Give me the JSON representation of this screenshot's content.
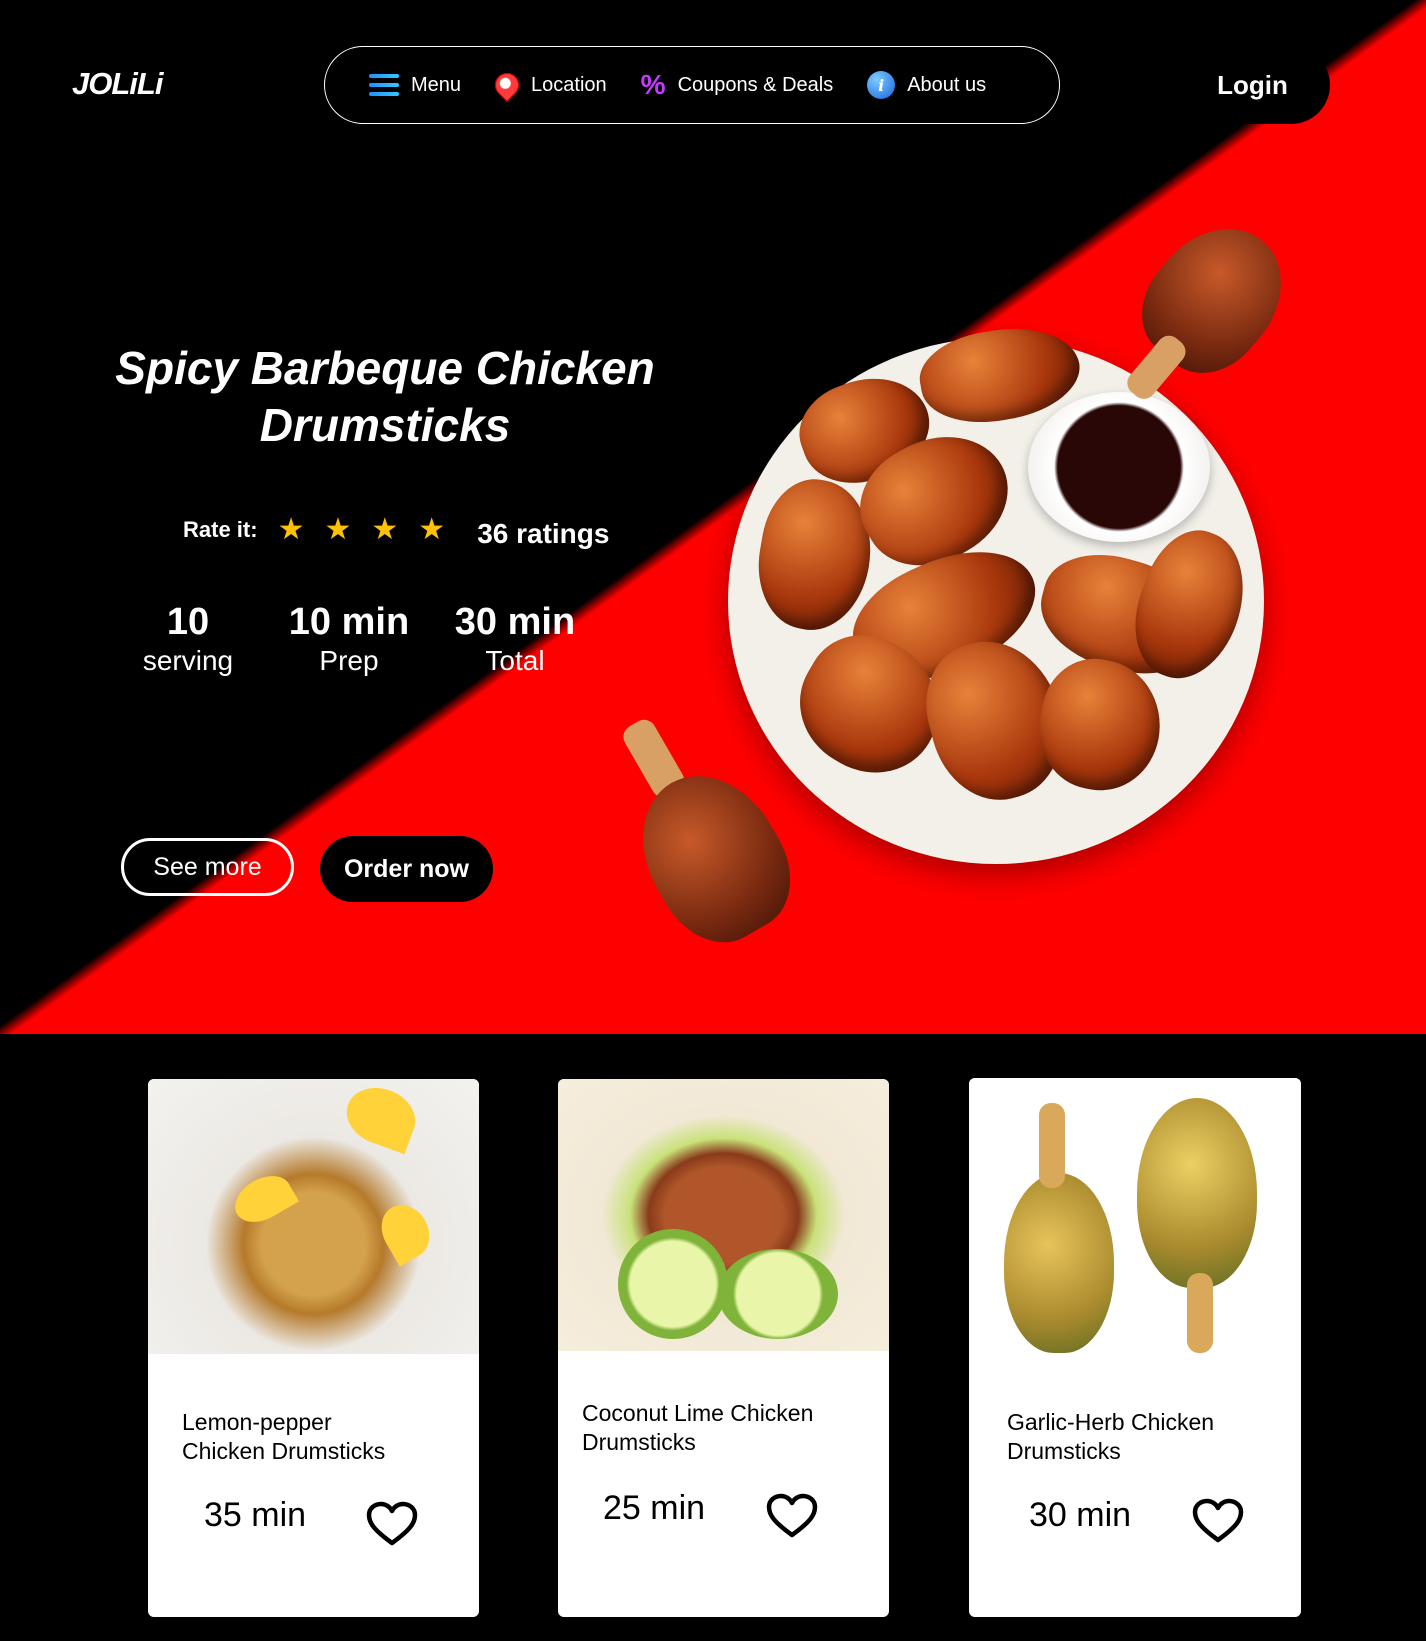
{
  "header": {
    "logo": "JOLiLi",
    "nav": [
      {
        "label": "Menu",
        "icon": "menu-icon"
      },
      {
        "label": "Location",
        "icon": "location-pin-icon"
      },
      {
        "label": "Coupons & Deals",
        "icon": "percent-icon"
      },
      {
        "label": "About us",
        "icon": "info-icon"
      }
    ],
    "login_label": "Login"
  },
  "hero": {
    "title_line1": "Spicy Barbeque Chicken",
    "title_line2": "Drumsticks",
    "rate_label": "Rate it:",
    "stars_filled": 4,
    "ratings_count": "36 ratings",
    "stats": [
      {
        "value": "10",
        "label": "serving"
      },
      {
        "value": "10 min",
        "label": "Prep"
      },
      {
        "value": "30 min",
        "label": "Total"
      }
    ],
    "see_more_label": "See more",
    "order_now_label": "Order now"
  },
  "cards": [
    {
      "name_line1": "Lemon-pepper",
      "name_line2": "Chicken Drumsticks",
      "time": "35 min"
    },
    {
      "name_line1": "Coconut Lime Chicken",
      "name_line2": "Drumsticks",
      "time": "25 min"
    },
    {
      "name_line1": "Garlic-Herb Chicken",
      "name_line2": "Drumsticks",
      "time": "30 min"
    }
  ],
  "colors": {
    "brand_red": "#ff0000",
    "black": "#000000",
    "star": "#ffc107"
  }
}
